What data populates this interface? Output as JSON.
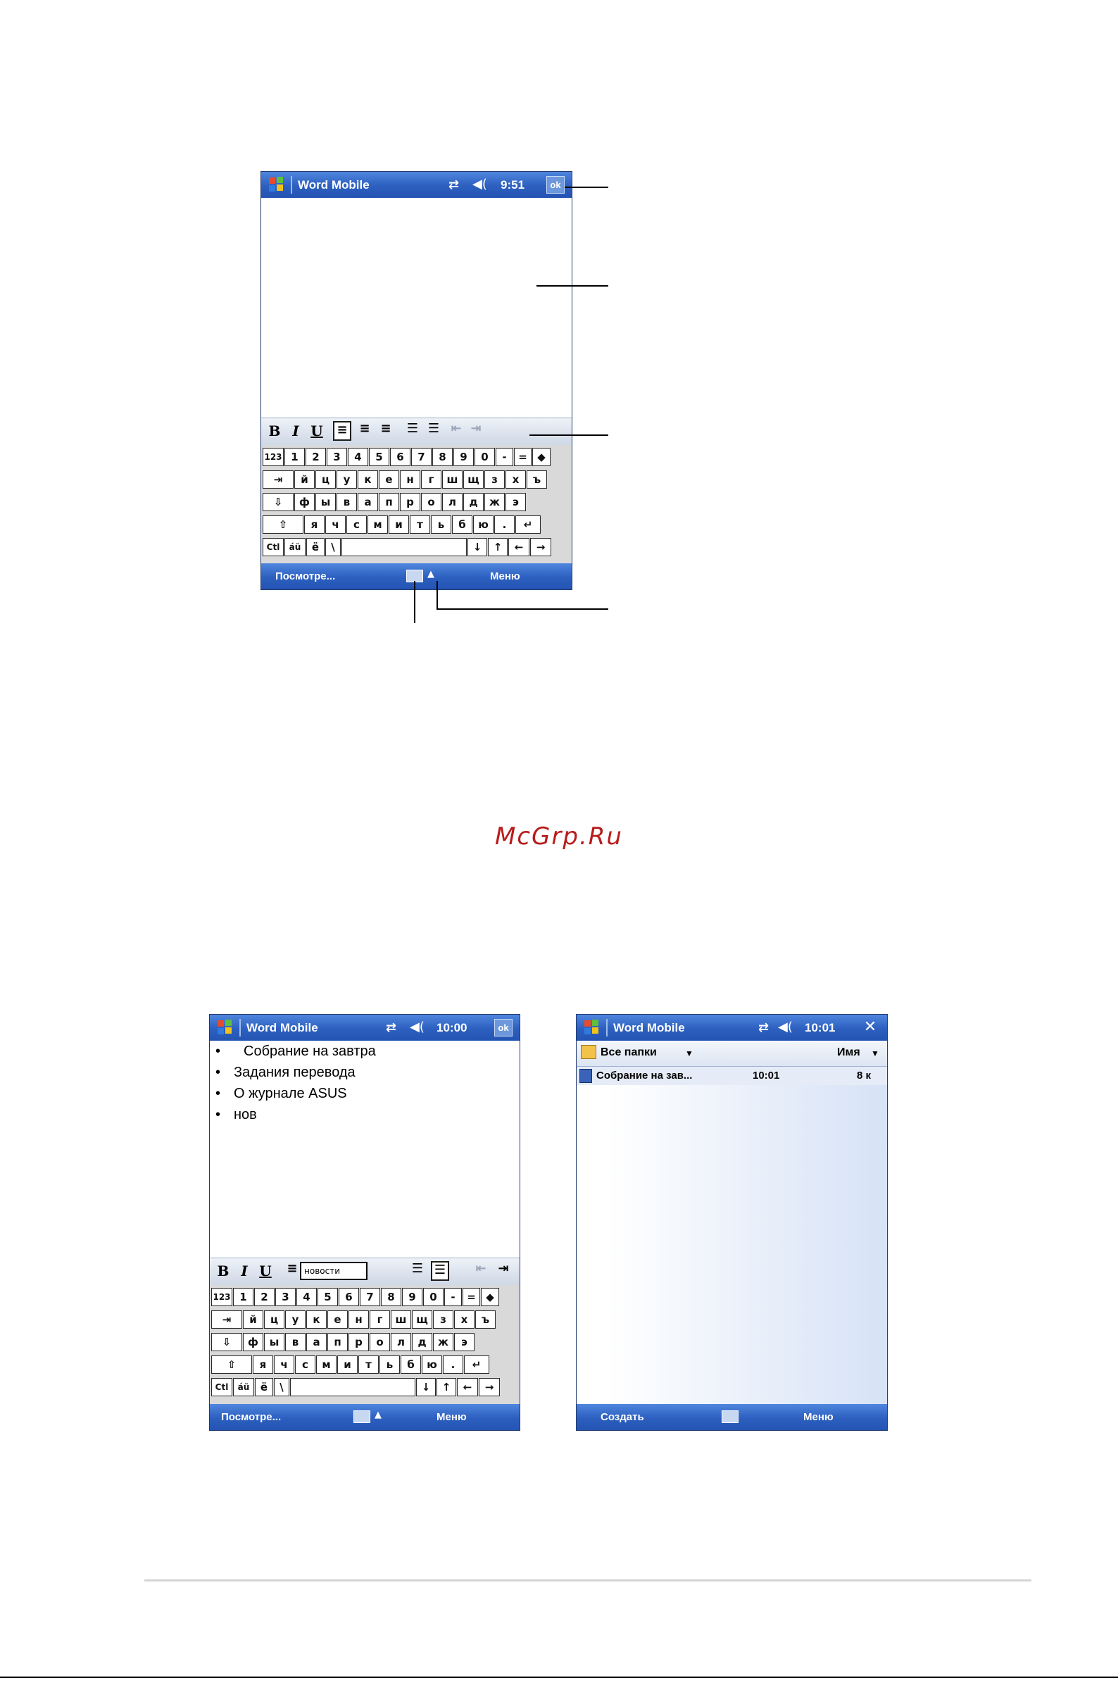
{
  "top_screen": {
    "title": "Word Mobile",
    "sync_icon": "sync-arrows",
    "speaker_icon": "speaker",
    "time": "9:51",
    "ok_label": "ok",
    "toolbar": {
      "bold": "B",
      "italic": "I",
      "underline": "U"
    },
    "softkey_left": "Посмотре...",
    "softkey_right": "Меню"
  },
  "keyboard": {
    "row1": [
      "123",
      "1",
      "2",
      "3",
      "4",
      "5",
      "6",
      "7",
      "8",
      "9",
      "0",
      "-",
      "=",
      "◆"
    ],
    "row2": [
      "⇥",
      "й",
      "ц",
      "у",
      "к",
      "е",
      "н",
      "г",
      "ш",
      "щ",
      "з",
      "х",
      "ъ"
    ],
    "row3": [
      "⇩",
      "ф",
      "ы",
      "в",
      "а",
      "п",
      "р",
      "о",
      "л",
      "д",
      "ж",
      "э"
    ],
    "row4": [
      "⇧",
      "я",
      "ч",
      "с",
      "м",
      "и",
      "т",
      "ь",
      "б",
      "ю",
      ".",
      "↵"
    ],
    "row5": [
      "Ctl",
      "áü",
      "ё",
      "\\",
      "",
      "↓",
      "↑",
      "←",
      "→"
    ]
  },
  "watermark": "McGrp.Ru",
  "bottom_left_screen": {
    "title": "Word Mobile",
    "time": "10:00",
    "ok_label": "ok",
    "lines": [
      "Собрание на завтра",
      "Задания перевода",
      "О журнале ASUS",
      "нов"
    ],
    "bullet": "•",
    "font_box": "новости",
    "toolbar": {
      "bold": "B",
      "italic": "I",
      "underline": "U"
    },
    "softkey_left": "Посмотре...",
    "softkey_right": "Меню"
  },
  "bottom_right_screen": {
    "title": "Word Mobile",
    "time": "10:01",
    "close_label": "✕",
    "folder_label": "Все папки",
    "sort_label": "Имя",
    "file": {
      "name": "Собрание на зав...",
      "time": "10:01",
      "size": "8 к"
    },
    "softkey_left": "Создать",
    "softkey_right": "Меню"
  },
  "colors": {
    "titlebar": "#2c5fbf",
    "watermark": "#b81c1c"
  }
}
